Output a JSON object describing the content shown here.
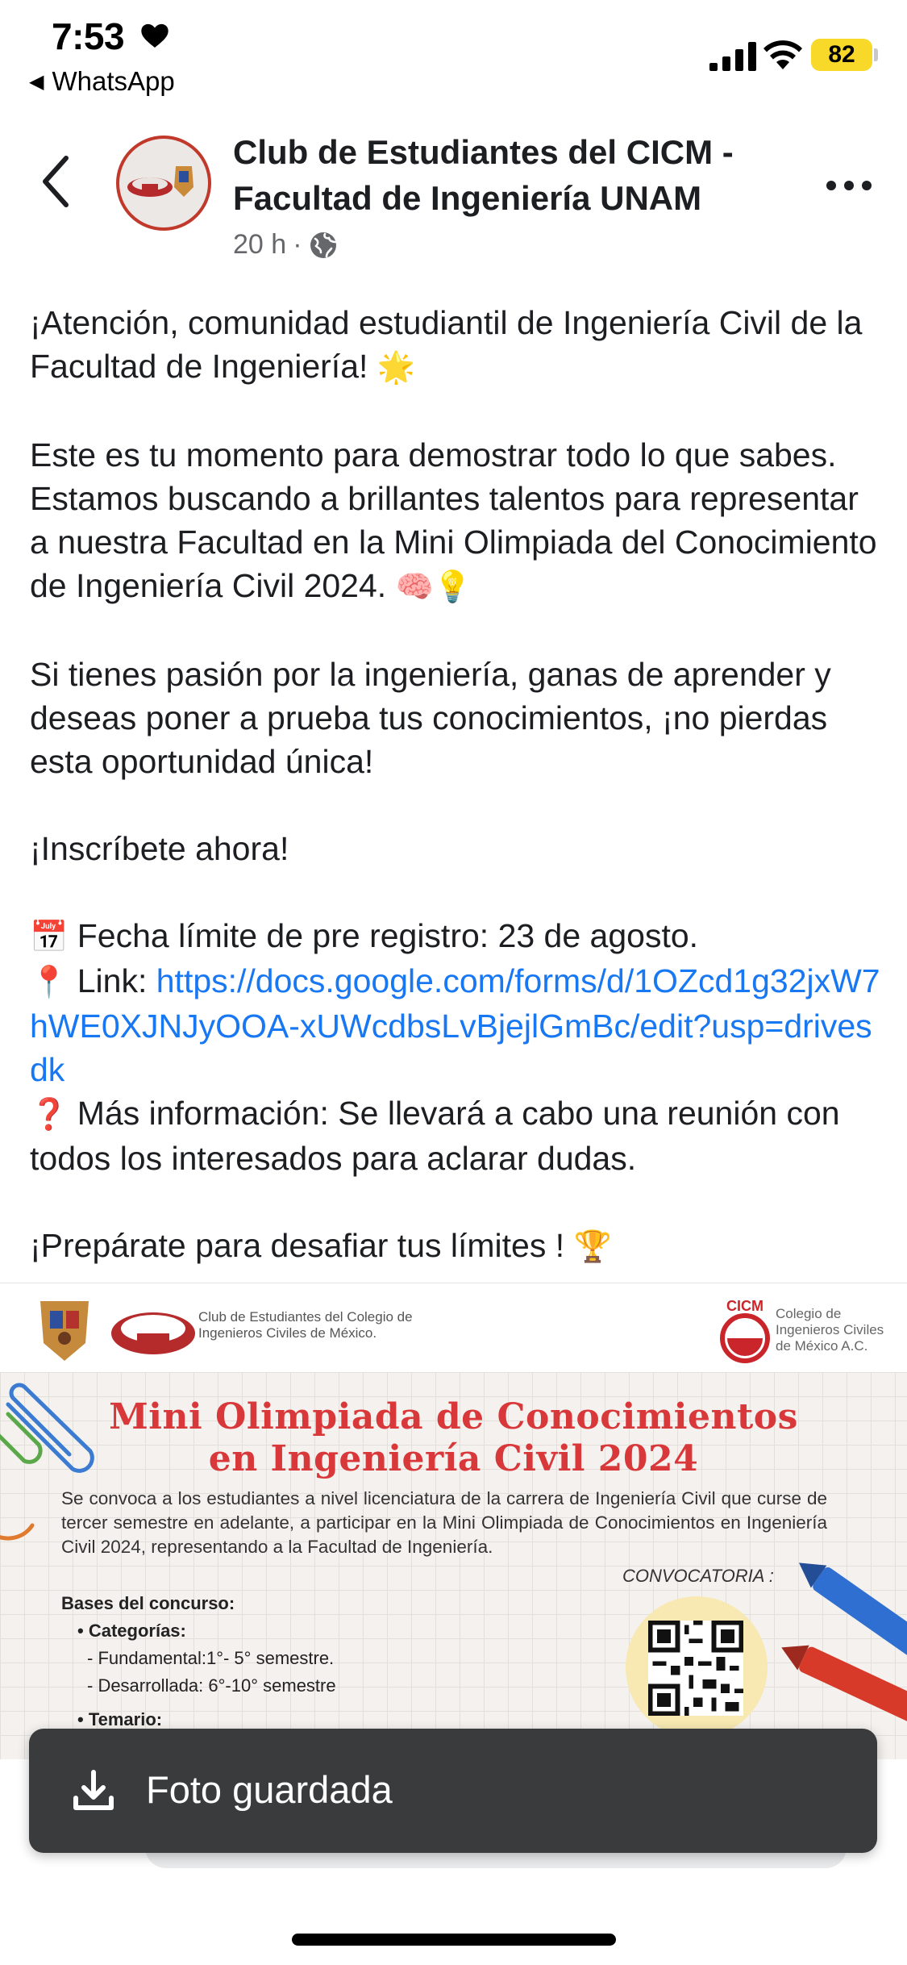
{
  "status_bar": {
    "time": "7:53",
    "back_app": "WhatsApp",
    "battery": "82",
    "battery_color": "#f8d92a"
  },
  "post": {
    "page_name": "Club de Estudiantes del CICM - Facultad de Ingeniería UNAM",
    "time_ago": "20 h",
    "dot": "·",
    "paragraphs": {
      "p1": "¡Atención, comunidad estudiantil de Ingeniería Civil de la Facultad de Ingeniería!",
      "p1_emoji": "🌟",
      "p2": "Este es tu momento para demostrar todo lo que sabes. Estamos buscando a brillantes talentos para representar a nuestra Facultad en la Mini Olimpiada del Conocimiento de Ingeniería Civil 2024.",
      "p2_emoji": "🧠💡",
      "p3": "Si tienes pasión por la ingeniería, ganas de aprender y deseas poner a prueba tus conocimientos, ¡no pierdas esta oportunidad única!",
      "p4": "¡Inscríbete ahora!",
      "deadline_emoji": "📅",
      "deadline": "Fecha límite de pre registro: 23 de agosto.",
      "link_emoji": "📍",
      "link_label": "Link:",
      "link_url": "https://docs.google.com/forms/d/1OZcd1g32jxW7hWE0XJNJyOOA-xUWcdbsLvBjejlGmBc/edit?usp=drivesdk",
      "info_emoji": "❓",
      "info": "Más información: Se llevará a cabo una reunión con todos los interesados para aclarar dudas.",
      "closing": "¡Prepárate para desafiar tus límites !",
      "closing_emoji": "🏆"
    }
  },
  "poster": {
    "club_caption_1": "Club de Estudiantes del Colegio de",
    "club_caption_2": "Ingenieros Civiles de México.",
    "cicm_caption_1": "Colegio de",
    "cicm_caption_2": "Ingenieros Civiles",
    "cicm_caption_3": "de México A.C.",
    "cicm_logo_text": "CICM",
    "title_1": "Mini Olimpiada de Conocimientos",
    "title_2": "en Ingeniería Civil 2024",
    "intro": "Se convoca a los estudiantes a nivel licenciatura de la carrera de Ingeniería Civil que curse de tercer semestre en adelante, a participar en la Mini Olimpiada de Conocimientos en Ingeniería Civil 2024, representando a la Facultad de Ingeniería.",
    "convocatoria": "CONVOCATORIA :",
    "bases": "Bases del concurso:",
    "categorias": "Categorías:",
    "cat_1": "- Fundamental:1°- 5° semestre.",
    "cat_2": "- Desarrollada: 6°-10° semestre",
    "temario": "Temario:",
    "title_color": "#d9383a"
  },
  "toast": {
    "text": "Foto guardada",
    "icon": "download-icon"
  }
}
